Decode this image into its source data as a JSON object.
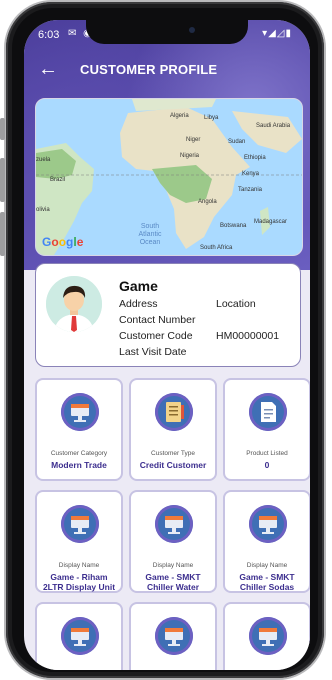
{
  "status_bar": {
    "time": "6:03",
    "left_icons": "✉ ◉",
    "right_icons": "▾◢◿▮"
  },
  "header": {
    "title": "CUSTOMER PROFILE",
    "back_icon": "arrow-left-icon"
  },
  "map": {
    "labels": {
      "algeria": "Algeria",
      "libya": "Libya",
      "saudi": "Saudi Arabia",
      "niger": "Niger",
      "sudan": "Sudan",
      "nigeria": "Nigeria",
      "ethiopia": "Ethiopia",
      "kenya": "Kenya",
      "tanzania": "Tanzania",
      "angola": "Angola",
      "madagascar": "Madagascar",
      "botswana": "Botswana",
      "south_africa": "South Africa",
      "brazil": "Brazil",
      "bolivia": "olivia",
      "venezuela": "zuela"
    },
    "ocean_label_1": "South",
    "ocean_label_2": "Atlantic",
    "ocean_label_3": "Ocean",
    "attribution": "Google"
  },
  "profile": {
    "name": "Game",
    "address_label": "Address",
    "location_label": "Location",
    "contact_label": "Contact Number",
    "code_label": "Customer Code",
    "code_value": "HM00000001",
    "last_visit_label": "Last Visit Date"
  },
  "tiles": [
    {
      "icon": "monitor-icon",
      "label": "Customer Category",
      "value": "Modern Trade"
    },
    {
      "icon": "notebook-icon",
      "label": "Customer Type",
      "value": "Credit Customer"
    },
    {
      "icon": "document-icon",
      "label": "Product Listed",
      "value": "0"
    },
    {
      "icon": "display-icon",
      "label": "Display Name",
      "value": "Game - Riham 2LTR Display Unit"
    },
    {
      "icon": "display-icon",
      "label": "Display Name",
      "value": "Game - SMKT Chiller Water"
    },
    {
      "icon": "display-icon",
      "label": "Display Name",
      "value": "Game - SMKT Chiller Sodas"
    },
    {
      "icon": "display-icon",
      "label": "",
      "value": ""
    },
    {
      "icon": "display-icon",
      "label": "",
      "value": ""
    },
    {
      "icon": "display-icon",
      "label": "",
      "value": ""
    }
  ],
  "colors": {
    "header": "#5a4cae",
    "accent": "#3d2f8f",
    "tile_border": "#c7c3e3",
    "icon_bg": "#3f6fb5"
  }
}
